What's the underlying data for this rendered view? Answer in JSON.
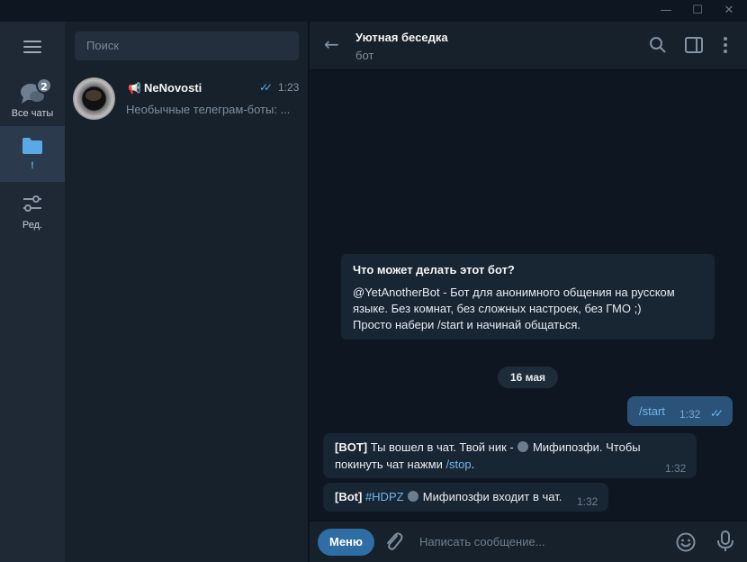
{
  "window": {
    "min_glyph": "—",
    "max_glyph": "☐",
    "close_glyph": "✕"
  },
  "rail": {
    "all_chats_label": "Все чаты",
    "all_chats_badge": "2",
    "folder_label": "!",
    "edit_label": "Ред."
  },
  "chatlist": {
    "search_placeholder": "Поиск",
    "items": [
      {
        "name": "NeNovosti",
        "time": "1:23",
        "preview": "Необычные телеграм-боты: ..."
      }
    ]
  },
  "conversation": {
    "title": "Уютная беседка",
    "subtitle": "бот",
    "bot_info": {
      "title": "Что может делать этот бот?",
      "body": "@YetAnotherBot - Бот для анонимного общения на русском\nязыке. Без комнат, без сложных настроек, без ГМО ;)\nПросто набери /start и начинай общаться."
    },
    "date": "16 мая",
    "outgoing": {
      "text": "/start",
      "time": "1:32"
    },
    "incoming": [
      {
        "prefix": "[BOT]",
        "text_a": " Ты вошел в чат. Твой ник - ",
        "text_b": " Мифипозфи. Чтобы",
        "text_c": "покинуть чат нажми ",
        "link": "/stop",
        "text_d": ".",
        "time": "1:32"
      },
      {
        "prefix": "[Bot]",
        "hashtag": " #HDPZ",
        "text": " Мифипозфи входит в чат.",
        "time": "1:32"
      }
    ],
    "composer": {
      "menu_label": "Меню",
      "placeholder": "Написать сообщение..."
    }
  },
  "colors": {
    "accent": "#5ba8e6",
    "outgoing_bubble": "#2b5278",
    "incoming_bubble": "#182533",
    "menu_button": "#2f6ea5"
  }
}
